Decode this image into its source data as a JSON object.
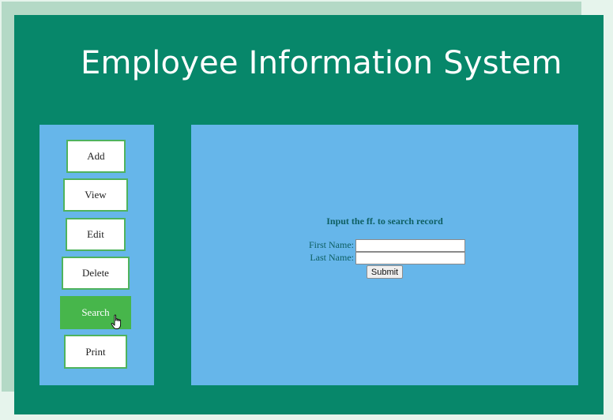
{
  "app": {
    "title": "Employee Information System"
  },
  "sidebar": {
    "items": [
      {
        "label": "Add"
      },
      {
        "label": "View"
      },
      {
        "label": "Edit"
      },
      {
        "label": "Delete"
      },
      {
        "label": "Search",
        "active": true
      },
      {
        "label": "Print"
      }
    ]
  },
  "search_form": {
    "heading": "Input the ff. to search record",
    "first_name_label": "First Name:",
    "first_name_value": "",
    "last_name_label": "Last Name:",
    "last_name_value": "",
    "submit_label": "Submit"
  },
  "colors": {
    "app_background": "#07876a",
    "panel_background": "#66b6ea",
    "active_button": "#47b64b",
    "button_border": "#4fb35d",
    "form_text": "#0e5f62"
  },
  "icons": {
    "cursor": "hand-pointer-icon"
  }
}
